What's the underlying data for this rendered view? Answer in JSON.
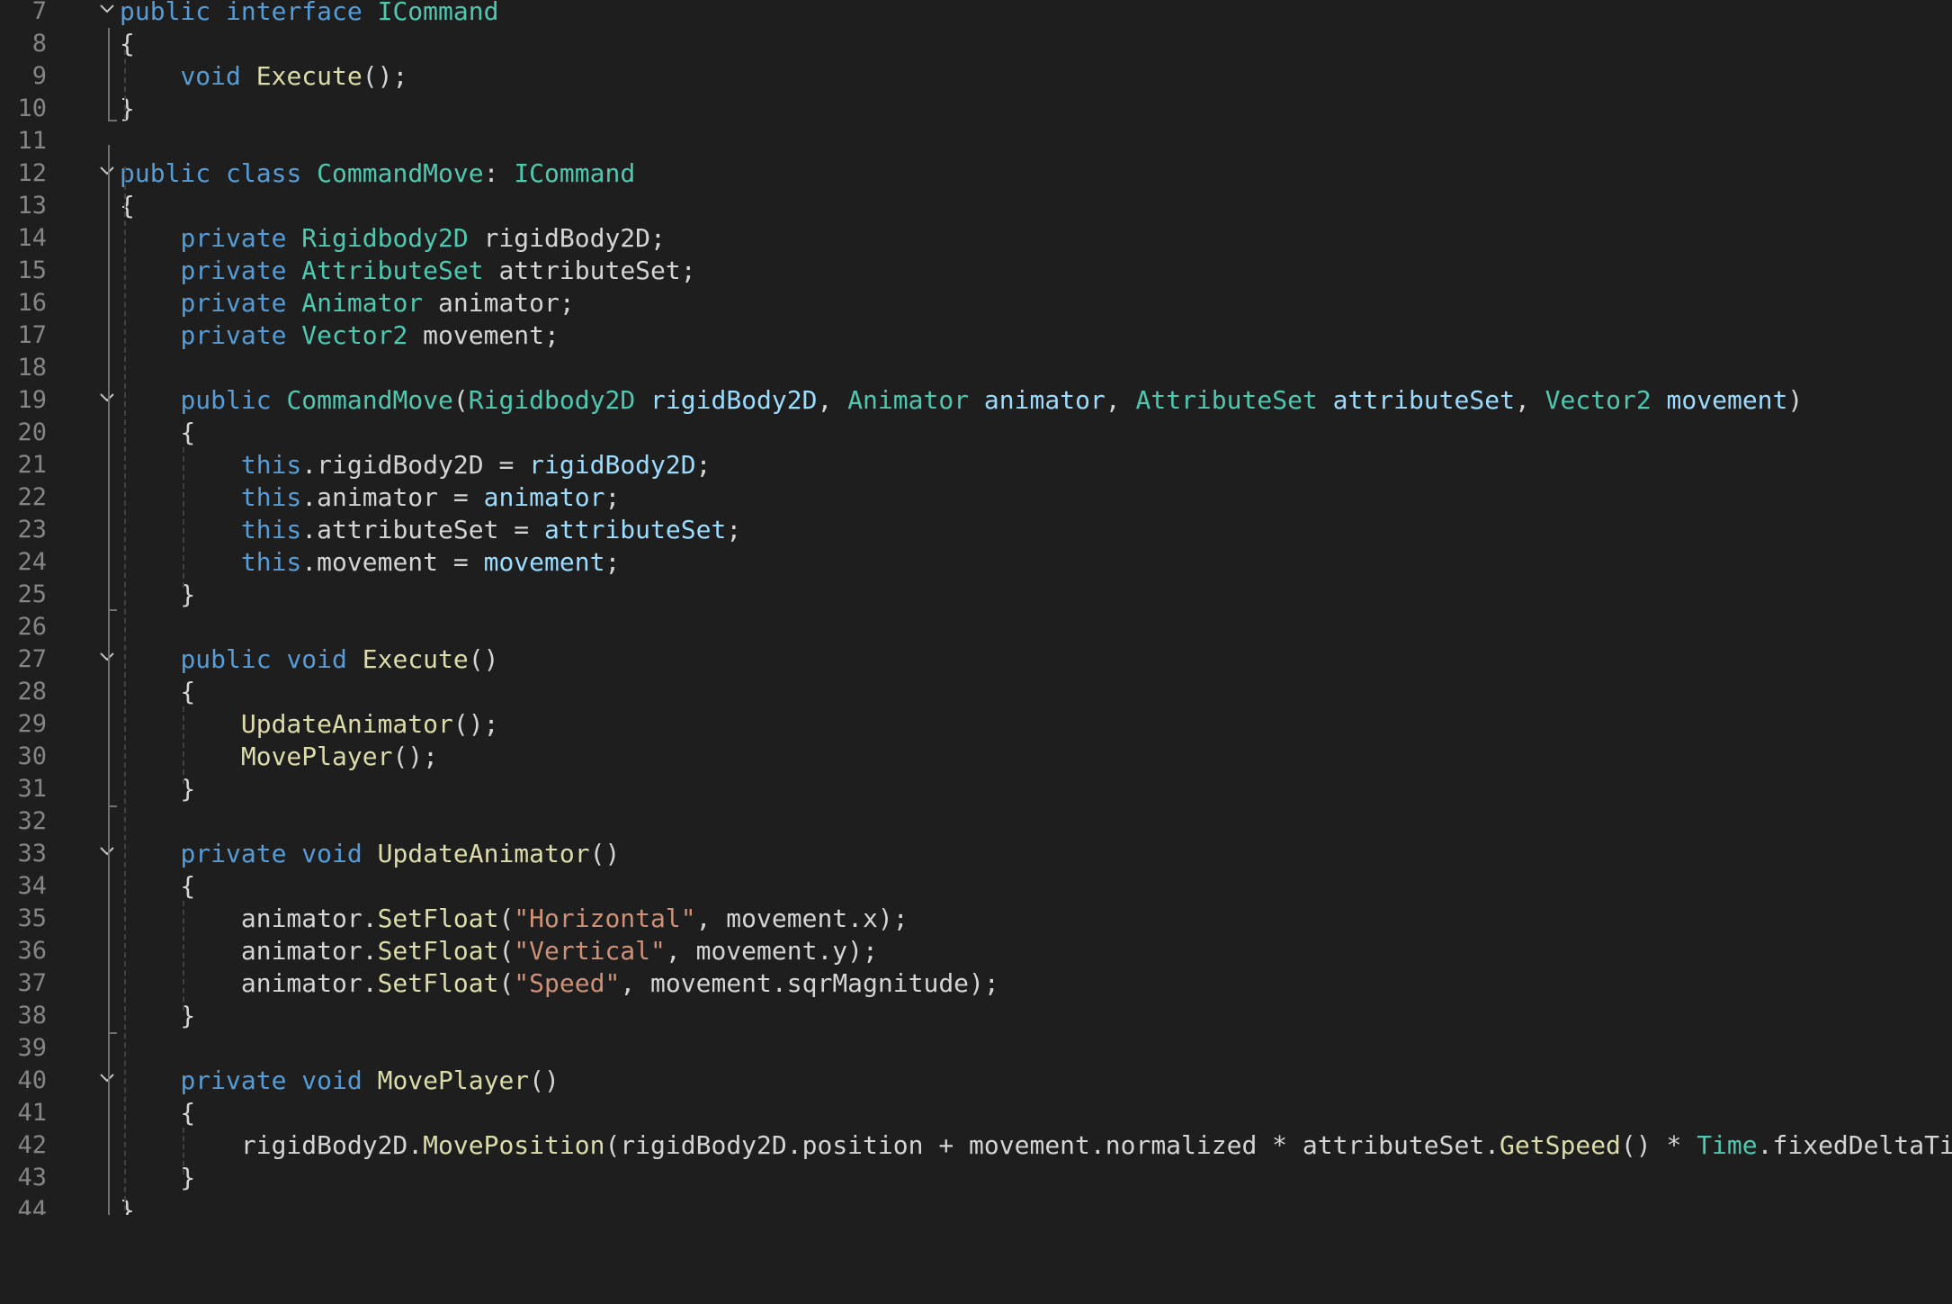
{
  "lines": [
    {
      "num": "7",
      "fold": true,
      "tokens": [
        [
          "kw",
          "public "
        ],
        [
          "kw",
          "interface "
        ],
        [
          "ty",
          "ICommand"
        ]
      ]
    },
    {
      "num": "8",
      "fold": false,
      "tokens": [
        [
          "pl",
          "{"
        ]
      ]
    },
    {
      "num": "9",
      "fold": false,
      "tokens": [
        [
          "pl",
          "    "
        ],
        [
          "kw",
          "void "
        ],
        [
          "fn",
          "Execute"
        ],
        [
          "pl",
          "();"
        ]
      ]
    },
    {
      "num": "10",
      "fold": false,
      "tokens": [
        [
          "pl",
          "}"
        ]
      ]
    },
    {
      "num": "11",
      "fold": false,
      "tokens": []
    },
    {
      "num": "12",
      "fold": true,
      "tokens": [
        [
          "kw",
          "public "
        ],
        [
          "kw",
          "class "
        ],
        [
          "ty",
          "CommandMove"
        ],
        [
          "pl",
          ": "
        ],
        [
          "ty",
          "ICommand"
        ]
      ]
    },
    {
      "num": "13",
      "fold": false,
      "tokens": [
        [
          "pl",
          "{"
        ]
      ]
    },
    {
      "num": "14",
      "fold": false,
      "tokens": [
        [
          "pl",
          "    "
        ],
        [
          "kw",
          "private "
        ],
        [
          "ty",
          "Rigidbody2D "
        ],
        [
          "pl",
          "rigidBody2D;"
        ]
      ]
    },
    {
      "num": "15",
      "fold": false,
      "tokens": [
        [
          "pl",
          "    "
        ],
        [
          "kw",
          "private "
        ],
        [
          "ty",
          "AttributeSet "
        ],
        [
          "pl",
          "attributeSet;"
        ]
      ]
    },
    {
      "num": "16",
      "fold": false,
      "tokens": [
        [
          "pl",
          "    "
        ],
        [
          "kw",
          "private "
        ],
        [
          "ty",
          "Animator "
        ],
        [
          "pl",
          "animator;"
        ]
      ]
    },
    {
      "num": "17",
      "fold": false,
      "tokens": [
        [
          "pl",
          "    "
        ],
        [
          "kw",
          "private "
        ],
        [
          "ty",
          "Vector2 "
        ],
        [
          "pl",
          "movement;"
        ]
      ]
    },
    {
      "num": "18",
      "fold": false,
      "tokens": []
    },
    {
      "num": "19",
      "fold": true,
      "tokens": [
        [
          "pl",
          "    "
        ],
        [
          "kw",
          "public "
        ],
        [
          "ty",
          "CommandMove"
        ],
        [
          "pl",
          "("
        ],
        [
          "ty",
          "Rigidbody2D "
        ],
        [
          "pa",
          "rigidBody2D"
        ],
        [
          "pl",
          ", "
        ],
        [
          "ty",
          "Animator "
        ],
        [
          "pa",
          "animator"
        ],
        [
          "pl",
          ", "
        ],
        [
          "ty",
          "AttributeSet "
        ],
        [
          "pa",
          "attributeSet"
        ],
        [
          "pl",
          ", "
        ],
        [
          "ty",
          "Vector2 "
        ],
        [
          "pa",
          "movement"
        ],
        [
          "pl",
          ")"
        ]
      ]
    },
    {
      "num": "20",
      "fold": false,
      "tokens": [
        [
          "pl",
          "    {"
        ]
      ]
    },
    {
      "num": "21",
      "fold": false,
      "tokens": [
        [
          "pl",
          "        "
        ],
        [
          "kw",
          "this"
        ],
        [
          "pl",
          ".rigidBody2D = "
        ],
        [
          "pa",
          "rigidBody2D"
        ],
        [
          "pl",
          ";"
        ]
      ]
    },
    {
      "num": "22",
      "fold": false,
      "tokens": [
        [
          "pl",
          "        "
        ],
        [
          "kw",
          "this"
        ],
        [
          "pl",
          ".animator = "
        ],
        [
          "pa",
          "animator"
        ],
        [
          "pl",
          ";"
        ]
      ]
    },
    {
      "num": "23",
      "fold": false,
      "tokens": [
        [
          "pl",
          "        "
        ],
        [
          "kw",
          "this"
        ],
        [
          "pl",
          ".attributeSet = "
        ],
        [
          "pa",
          "attributeSet"
        ],
        [
          "pl",
          ";"
        ]
      ]
    },
    {
      "num": "24",
      "fold": false,
      "tokens": [
        [
          "pl",
          "        "
        ],
        [
          "kw",
          "this"
        ],
        [
          "pl",
          ".movement = "
        ],
        [
          "pa",
          "movement"
        ],
        [
          "pl",
          ";"
        ]
      ]
    },
    {
      "num": "25",
      "fold": false,
      "tokens": [
        [
          "pl",
          "    }"
        ]
      ]
    },
    {
      "num": "26",
      "fold": false,
      "tokens": []
    },
    {
      "num": "27",
      "fold": true,
      "tokens": [
        [
          "pl",
          "    "
        ],
        [
          "kw",
          "public "
        ],
        [
          "kw",
          "void "
        ],
        [
          "fn",
          "Execute"
        ],
        [
          "pl",
          "()"
        ]
      ]
    },
    {
      "num": "28",
      "fold": false,
      "tokens": [
        [
          "pl",
          "    {"
        ]
      ]
    },
    {
      "num": "29",
      "fold": false,
      "tokens": [
        [
          "pl",
          "        "
        ],
        [
          "fn",
          "UpdateAnimator"
        ],
        [
          "pl",
          "();"
        ]
      ]
    },
    {
      "num": "30",
      "fold": false,
      "tokens": [
        [
          "pl",
          "        "
        ],
        [
          "fn",
          "MovePlayer"
        ],
        [
          "pl",
          "();"
        ]
      ]
    },
    {
      "num": "31",
      "fold": false,
      "tokens": [
        [
          "pl",
          "    }"
        ]
      ]
    },
    {
      "num": "32",
      "fold": false,
      "tokens": []
    },
    {
      "num": "33",
      "fold": true,
      "tokens": [
        [
          "pl",
          "    "
        ],
        [
          "kw",
          "private "
        ],
        [
          "kw",
          "void "
        ],
        [
          "fn",
          "UpdateAnimator"
        ],
        [
          "pl",
          "()"
        ]
      ]
    },
    {
      "num": "34",
      "fold": false,
      "tokens": [
        [
          "pl",
          "    {"
        ]
      ]
    },
    {
      "num": "35",
      "fold": false,
      "tokens": [
        [
          "pl",
          "        animator."
        ],
        [
          "fn",
          "SetFloat"
        ],
        [
          "pl",
          "("
        ],
        [
          "st",
          "\"Horizontal\""
        ],
        [
          "pl",
          ", movement.x);"
        ]
      ]
    },
    {
      "num": "36",
      "fold": false,
      "tokens": [
        [
          "pl",
          "        animator."
        ],
        [
          "fn",
          "SetFloat"
        ],
        [
          "pl",
          "("
        ],
        [
          "st",
          "\"Vertical\""
        ],
        [
          "pl",
          ", movement.y);"
        ]
      ]
    },
    {
      "num": "37",
      "fold": false,
      "tokens": [
        [
          "pl",
          "        animator."
        ],
        [
          "fn",
          "SetFloat"
        ],
        [
          "pl",
          "("
        ],
        [
          "st",
          "\"Speed\""
        ],
        [
          "pl",
          ", movement.sqrMagnitude);"
        ]
      ]
    },
    {
      "num": "38",
      "fold": false,
      "tokens": [
        [
          "pl",
          "    }"
        ]
      ]
    },
    {
      "num": "39",
      "fold": false,
      "tokens": []
    },
    {
      "num": "40",
      "fold": true,
      "tokens": [
        [
          "pl",
          "    "
        ],
        [
          "kw",
          "private "
        ],
        [
          "kw",
          "void "
        ],
        [
          "fn",
          "MovePlayer"
        ],
        [
          "pl",
          "()"
        ]
      ]
    },
    {
      "num": "41",
      "fold": false,
      "tokens": [
        [
          "pl",
          "    {"
        ]
      ]
    },
    {
      "num": "42",
      "fold": false,
      "tokens": [
        [
          "pl",
          "        rigidBody2D."
        ],
        [
          "fn",
          "MovePosition"
        ],
        [
          "pl",
          "(rigidBody2D.position + movement.normalized * attributeSet."
        ],
        [
          "fn",
          "GetSpeed"
        ],
        [
          "pl",
          "() * "
        ],
        [
          "ty",
          "Time"
        ],
        [
          "pl",
          ".fixedDeltaTime);"
        ]
      ]
    },
    {
      "num": "43",
      "fold": false,
      "tokens": [
        [
          "pl",
          "    }"
        ]
      ]
    },
    {
      "num": "44",
      "fold": false,
      "tokens": [
        [
          "pl",
          "}"
        ]
      ]
    }
  ],
  "colors": {
    "keyword": "#569cd6",
    "type": "#4ec9b0",
    "function": "#dcdcaa",
    "parameter": "#9cdcfe",
    "string": "#ce9178",
    "plain": "#d4d4d4",
    "line_number": "#858585",
    "background": "#1e1e1e"
  },
  "icons": {
    "fold": "chevron-down-icon"
  }
}
